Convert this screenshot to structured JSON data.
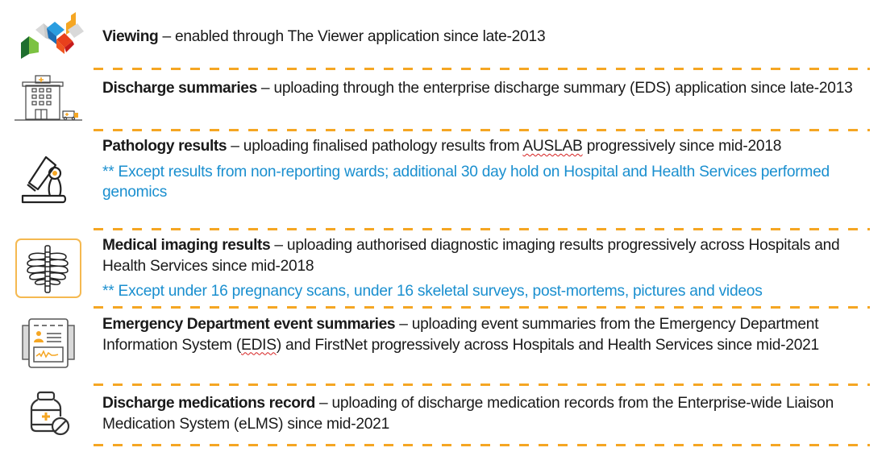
{
  "colors": {
    "divider": "#f5a623",
    "note_text": "#1a8fcf",
    "body_text": "#1a1a1a",
    "spellcheck": "#d62020"
  },
  "items": [
    {
      "icon": "viewer-logo-icon",
      "title": "Viewing",
      "separator": " – ",
      "description": "enabled through The Viewer application since late-2013"
    },
    {
      "icon": "hospital-ambulance-icon",
      "title": "Discharge summaries",
      "separator": " – ",
      "description": "uploading through the enterprise discharge summary (EDS) application since late-2013"
    },
    {
      "icon": "microscope-icon",
      "title": "Pathology results",
      "separator": " – ",
      "description_pre": "uploading finalised pathology results from ",
      "description_flagged": "AUSLAB",
      "description_post": " progressively since mid-2018",
      "note": "** Except results from non-reporting wards; additional 30 day hold on Hospital and Health Services performed genomics"
    },
    {
      "icon": "xray-ribcage-icon",
      "title": "Medical imaging results",
      "separator": " – ",
      "description": "uploading authorised diagnostic imaging results progressively across Hospitals and Health Services since mid-2018",
      "note": "** Except under 16 pregnancy scans, under 16 skeletal surveys, post-mortems, pictures and videos"
    },
    {
      "icon": "event-summary-document-icon",
      "title": "Emergency Department event summaries",
      "separator": " – ",
      "description_pre": "uploading event summaries from the Emergency Department Information System (",
      "description_flagged": "EDIS",
      "description_post": ") and FirstNet progressively across Hospitals and Health Services since mid-2021"
    },
    {
      "icon": "medication-bottle-icon",
      "title": "Discharge medications record",
      "separator": " – ",
      "description": "uploading of discharge medication records from the Enterprise-wide Liaison Medication System (eLMS) since mid-2021"
    }
  ]
}
